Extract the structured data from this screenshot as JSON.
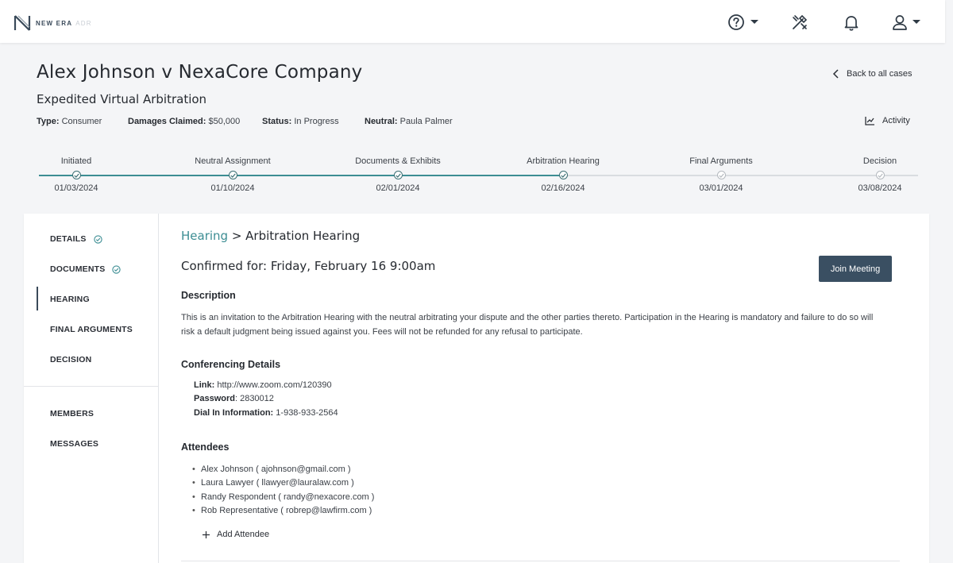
{
  "brand": {
    "name": "NEW ERA",
    "sub": "ADR"
  },
  "topbar": {
    "icons": [
      "help-icon",
      "tools-icon",
      "bell-icon",
      "user-icon"
    ]
  },
  "case": {
    "title": "Alex Johnson v NexaCore Company",
    "subtitle": "Expedited Virtual Arbitration",
    "meta": {
      "type_label": "Type:",
      "type_value": "Consumer",
      "damages_label": "Damages Claimed:",
      "damages_value": "$50,000",
      "status_label": "Status:",
      "status_value": "In Progress",
      "neutral_label": "Neutral:",
      "neutral_value": "Paula Palmer"
    },
    "back_label": "Back to all cases",
    "activity_label": "Activity"
  },
  "steps": [
    {
      "label": "Initiated",
      "date": "01/03/2024",
      "done": true
    },
    {
      "label": "Neutral Assignment",
      "date": "01/10/2024",
      "done": true
    },
    {
      "label": "Documents & Exhibits",
      "date": "02/01/2024",
      "done": true
    },
    {
      "label": "Arbitration Hearing",
      "date": "02/16/2024",
      "done": true
    },
    {
      "label": "Final Arguments",
      "date": "03/01/2024",
      "done": false
    },
    {
      "label": "Decision",
      "date": "03/08/2024",
      "done": false
    }
  ],
  "nav": {
    "details": "DETAILS",
    "documents": "DOCUMENTS",
    "hearing": "HEARING",
    "final_arguments": "FINAL ARGUMENTS",
    "decision": "DECISION",
    "members": "MEMBERS",
    "messages": "MESSAGES"
  },
  "main": {
    "crumb_link": "Hearing",
    "crumb_sep": " > ",
    "crumb_current": "Arbitration Hearing",
    "confirmed": "Confirmed for: Friday, February 16 9:00am",
    "join_label": "Join Meeting",
    "description_title": "Description",
    "description": "This is an invitation to the Arbitration Hearing with the neutral arbitrating your dispute and the other parties thereto. Participation in the Hearing is mandatory and failure to do so will risk a default judgment being issued against you. Fees will not be refunded for any refusal to participate.",
    "conf_title": "Conferencing Details",
    "link_label": "Link:",
    "link_value": " http://www.zoom.com/120390",
    "password_label": "Password",
    "password_value": ": 2830012",
    "dial_label": "Dial In Information:",
    "dial_value": " 1-938-933-2564",
    "attendees_title": "Attendees",
    "attendees": [
      "Alex Johnson ( ajohnson@gmail.com )",
      "Laura Lawyer ( llawyer@lauralaw.com )",
      "Randy Respondent ( randy@nexacore.com )",
      "Rob Representative ( robrep@lawfirm.com )"
    ],
    "add_attendee": "Add Attendee"
  },
  "colors": {
    "teal": "#3c8d93",
    "button": "#3a4f62",
    "track": "#d9dce0"
  }
}
